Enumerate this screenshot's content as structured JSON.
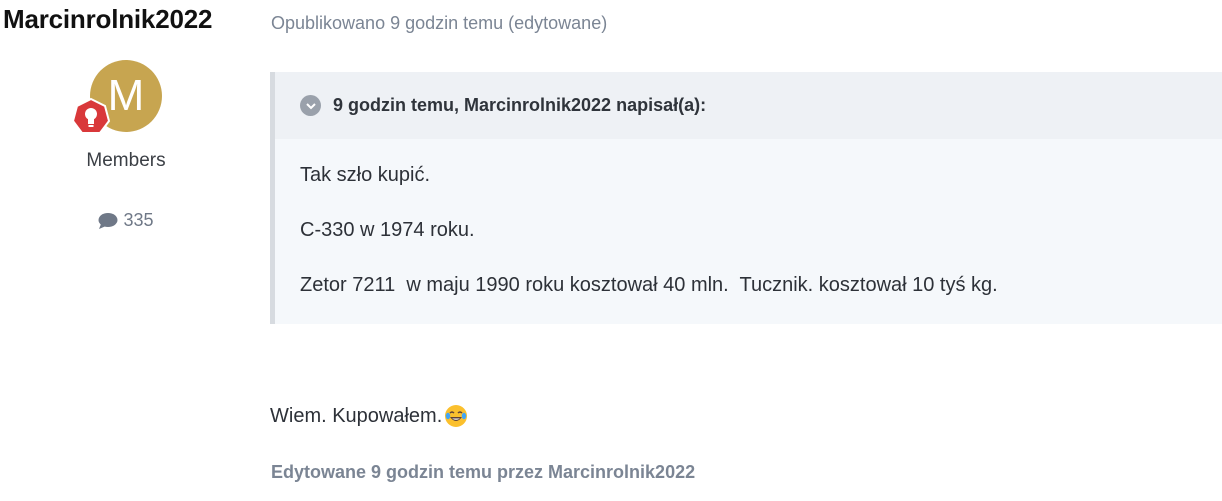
{
  "author": {
    "name": "Marcinrolnik2022",
    "avatar_letter": "M",
    "avatar_color": "#c7a550",
    "badge_color": "#d9383a",
    "badge_icon": "lightbulb-icon",
    "group": "Members",
    "post_count": "335",
    "post_count_icon": "speech-bubble-icon"
  },
  "post": {
    "meta": "Opublikowano 9 godzin temu (edytowane)",
    "quote": {
      "header": "9 godzin temu, Marcinrolnik2022 napisał(a):",
      "toggle_icon": "chevron-down-circle-icon",
      "lines": [
        "Tak szło kupić.",
        "C-330 w 1974 roku.",
        "Zetor 7211  w maju 1990 roku kosztował 40 mln.  Tucznik. kosztował 10 tyś kg."
      ]
    },
    "text": "Wiem. Kupowałem.",
    "emoji": "tears-of-joy-emoji",
    "edited_note": "Edytowane 9 godzin temu przez Marcinrolnik2022"
  }
}
